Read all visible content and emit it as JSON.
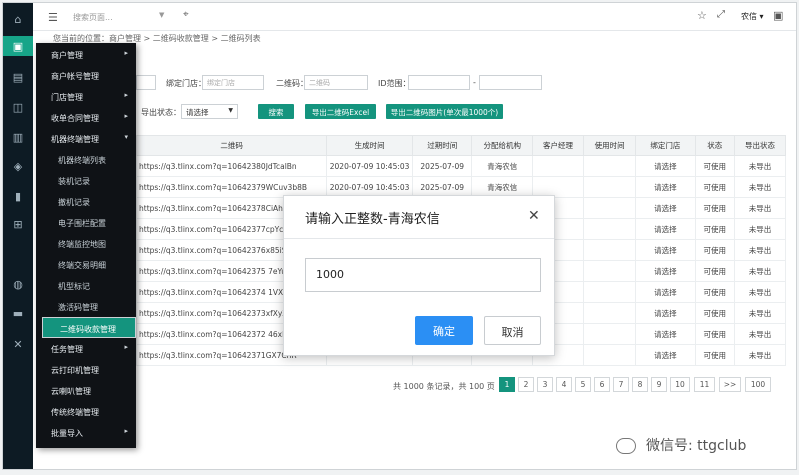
{
  "rail": {
    "icons": [
      "home-icon",
      "store-icon",
      "card-icon",
      "briefcase-icon",
      "building-icon",
      "shield-icon",
      "chart-icon",
      "plus-box-icon",
      "globe-icon",
      "terminal-icon",
      "tools-icon"
    ],
    "active_index": 1
  },
  "header": {
    "search_placeholder": "搜索页面...",
    "user_label": "农信 ▾",
    "icons": [
      "menu-icon",
      "tag-icon",
      "star-icon",
      "fullscreen-icon",
      "account-icon"
    ]
  },
  "breadcrumb": "您当前的位置：商户管理 > 二维码收款管理 > 二维码列表",
  "filters": {
    "store_label": "绑定门店：",
    "store_placeholder": "绑定门店",
    "qr_label": "二维码：",
    "qr_placeholder": "二维码",
    "id_range_label": "ID范围：",
    "range_sep": "-",
    "export_status_label": "导出状态：",
    "export_status_value": "请选择",
    "search_button": "搜索",
    "export_excel_button": "导出二维码Excel",
    "export_images_button": "导出二维码图片(单次最1000个)"
  },
  "table": {
    "columns": [
      "二维码",
      "生成时间",
      "过期时间",
      "分配给机构",
      "客户经理",
      "使用时间",
      "绑定门店",
      "状态",
      "导出状态"
    ],
    "rows": [
      [
        "https://q3.tlinx.com?q=10642380JdTcalBn",
        "2020-07-09 10:45:03",
        "2025-07-09",
        "青海农信",
        "",
        "",
        "请选择",
        "可使用",
        "未导出"
      ],
      [
        "https://q3.tlinx.com?q=10642379WCuv3b8B",
        "2020-07-09 10:45:03",
        "2025-07-09",
        "青海农信",
        "",
        "",
        "请选择",
        "可使用",
        "未导出"
      ],
      [
        "https://q3.tlinx.com?q=10642378CiAhSH",
        "",
        "",
        "",
        "",
        "",
        "请选择",
        "可使用",
        "未导出"
      ],
      [
        "https://q3.tlinx.com?q=10642377cpYcfG",
        "",
        "",
        "",
        "",
        "",
        "请选择",
        "可使用",
        "未导出"
      ],
      [
        "https://q3.tlinx.com?q=10642376x85iSV",
        "",
        "",
        "",
        "",
        "",
        "请选择",
        "可使用",
        "未导出"
      ],
      [
        "https://q3.tlinx.com?q=10642375 7eYuzg",
        "",
        "",
        "",
        "",
        "",
        "请选择",
        "可使用",
        "未导出"
      ],
      [
        "https://q3.tlinx.com?q=10642374 1VXjF",
        "",
        "",
        "",
        "",
        "",
        "请选择",
        "可使用",
        "未导出"
      ],
      [
        "https://q3.tlinx.com?q=10642373xfXyZP",
        "",
        "",
        "",
        "",
        "",
        "请选择",
        "可使用",
        "未导出"
      ],
      [
        "https://q3.tlinx.com?q=10642372 46xRJ",
        "",
        "",
        "",
        "",
        "",
        "请选择",
        "可使用",
        "未导出"
      ],
      [
        "https://q3.tlinx.com?q=10642371GX7CnR",
        "",
        "",
        "",
        "",
        "",
        "请选择",
        "可使用",
        "未导出"
      ]
    ]
  },
  "pagination": {
    "summary": "共 1000 条记录，共 100 页",
    "pages": [
      "1",
      "2",
      "3",
      "4",
      "5",
      "6",
      "7",
      "8",
      "9",
      "10",
      "11",
      ">>",
      "100"
    ],
    "current": "1"
  },
  "menu": {
    "items": [
      {
        "label": "商户管理",
        "arrow": "▸",
        "type": "top"
      },
      {
        "label": "商户帐号管理",
        "type": "top"
      },
      {
        "label": "门店管理",
        "arrow": "▸",
        "type": "top"
      },
      {
        "label": "收单合同管理",
        "arrow": "▸",
        "type": "top"
      },
      {
        "label": "机器终端管理",
        "arrow": "▾",
        "type": "top"
      },
      {
        "label": "机器终端列表",
        "type": "sub"
      },
      {
        "label": "装机记录",
        "type": "sub"
      },
      {
        "label": "撤机记录",
        "type": "sub"
      },
      {
        "label": "电子围栏配置",
        "type": "sub"
      },
      {
        "label": "终端监控地图",
        "type": "sub"
      },
      {
        "label": "终端交易明细",
        "type": "sub"
      },
      {
        "label": "机型标记",
        "type": "sub"
      },
      {
        "label": "激活码管理",
        "type": "sub"
      },
      {
        "label": "二维码收款管理",
        "type": "selected"
      },
      {
        "label": "任务管理",
        "arrow": "▸",
        "type": "top"
      },
      {
        "label": "云打印机管理",
        "type": "top"
      },
      {
        "label": "云喇叭管理",
        "type": "top"
      },
      {
        "label": "传统终端管理",
        "type": "top"
      },
      {
        "label": "批量导入",
        "arrow": "▸",
        "type": "top"
      }
    ]
  },
  "modal": {
    "title": "请输入正整数-青海农信",
    "value": "1000",
    "ok": "确定",
    "cancel": "取消"
  },
  "watermark": "微信号: ttgclub",
  "colors": {
    "accent": "#14947e",
    "primary_button": "#2b8ff4",
    "rail_bg": "#0d1b24",
    "menu_bg": "#0f1216"
  }
}
